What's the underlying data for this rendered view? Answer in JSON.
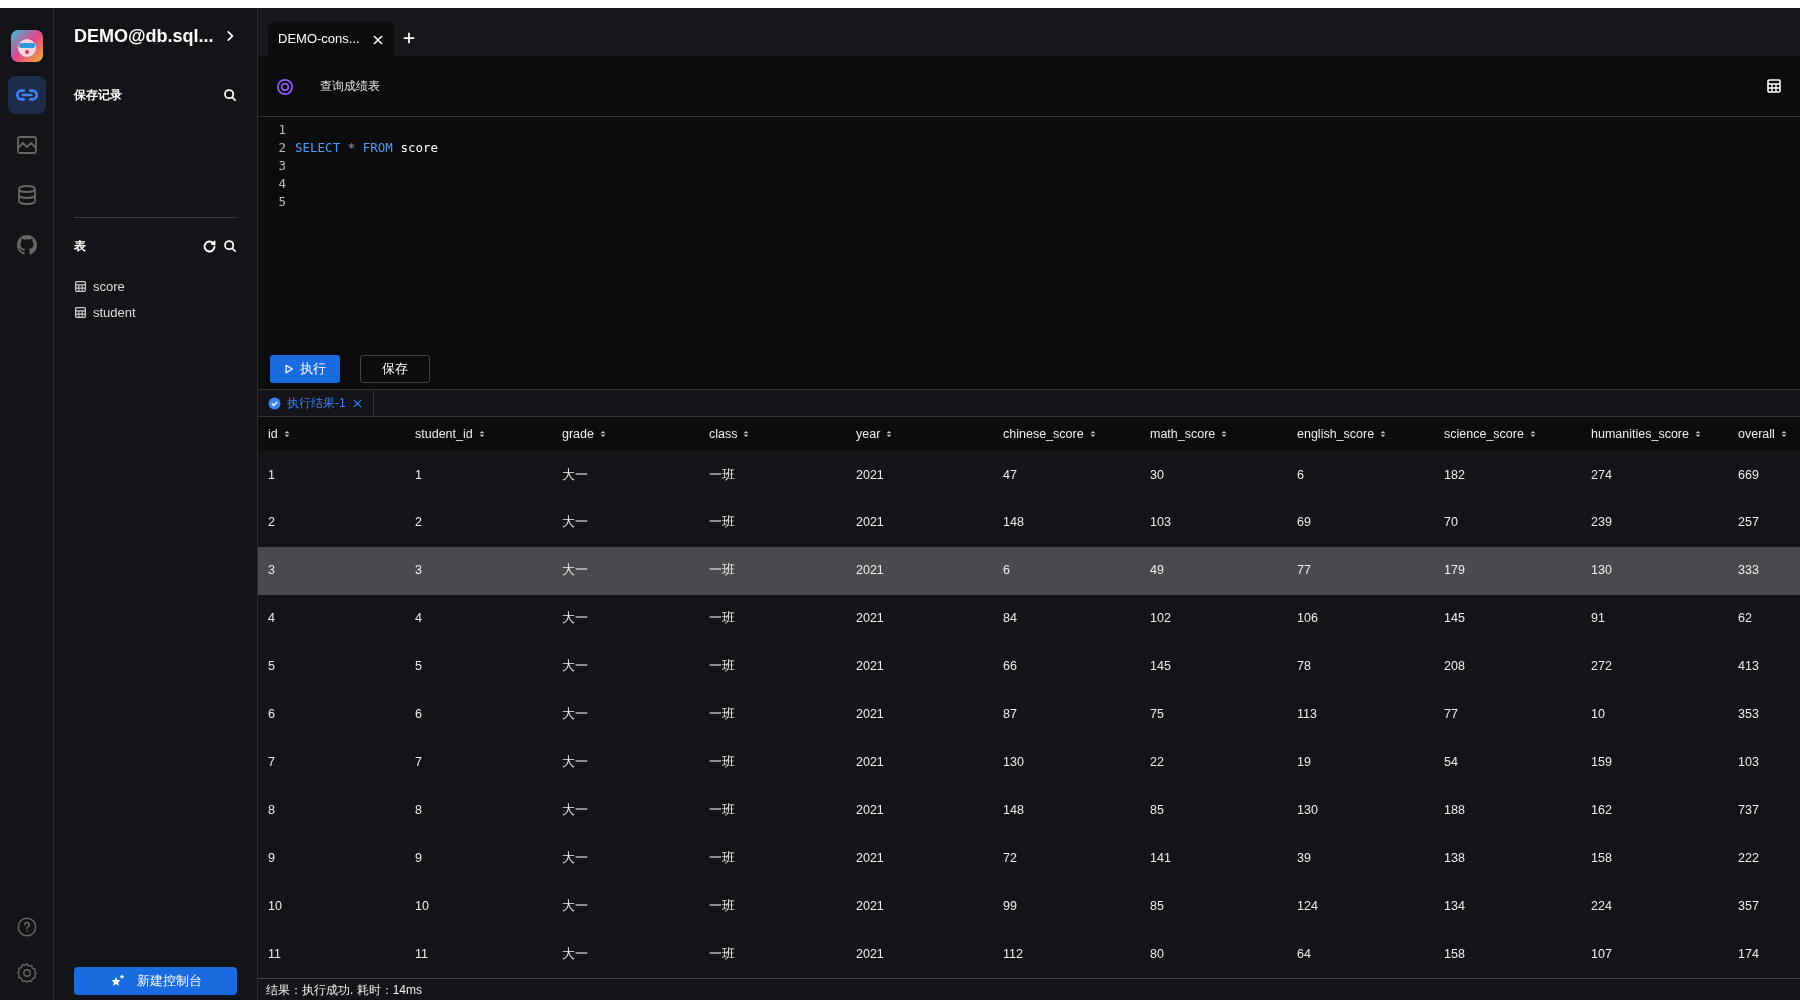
{
  "rail": [
    {
      "kind": "link",
      "selected": true
    },
    {
      "kind": "chart",
      "selected": false
    },
    {
      "kind": "database",
      "selected": false
    },
    {
      "kind": "cat",
      "selected": false
    }
  ],
  "rail_bottom": [
    {
      "kind": "help"
    },
    {
      "kind": "settings"
    }
  ],
  "connection": {
    "title": "DEMO@db.sql..."
  },
  "saved": {
    "title": "保存记录"
  },
  "tables": {
    "title": "表",
    "items": [
      {
        "name": "score"
      },
      {
        "name": "student"
      }
    ]
  },
  "new_console_button": "新建控制台",
  "tabs": [
    {
      "label": "DEMO-cons...",
      "selected": true
    }
  ],
  "query_title": "查询成绩表",
  "editor": {
    "lines": [
      {
        "number": "1"
      },
      {
        "number": "2",
        "tokens": [
          {
            "text": "SELECT",
            "kind": "keyword"
          },
          {
            "text": "*",
            "kind": "operator"
          },
          {
            "text": "FROM",
            "kind": "keyword"
          },
          {
            "text": "score",
            "kind": "name"
          }
        ]
      },
      {
        "number": "3"
      },
      {
        "number": "4"
      },
      {
        "number": "5"
      }
    ]
  },
  "buttons": {
    "run": "执行",
    "save": "保存"
  },
  "result_tabs": [
    {
      "label": "执行结果-1",
      "selected": true
    }
  ],
  "table": {
    "columns": [
      "id",
      "student_id",
      "grade",
      "class",
      "year",
      "chinese_score",
      "math_score",
      "english_score",
      "science_score",
      "humanities_score",
      "overall"
    ],
    "rows": [
      {
        "selected": false,
        "cells": [
          "1",
          "1",
          "大一",
          "一班",
          "2021",
          "47",
          "30",
          "6",
          "182",
          "274",
          "669"
        ]
      },
      {
        "selected": false,
        "cells": [
          "2",
          "2",
          "大一",
          "一班",
          "2021",
          "148",
          "103",
          "69",
          "70",
          "239",
          "257"
        ]
      },
      {
        "selected": true,
        "cells": [
          "3",
          "3",
          "大一",
          "一班",
          "2021",
          "6",
          "49",
          "77",
          "179",
          "130",
          "333"
        ]
      },
      {
        "selected": false,
        "cells": [
          "4",
          "4",
          "大一",
          "一班",
          "2021",
          "84",
          "102",
          "106",
          "145",
          "91",
          "62"
        ]
      },
      {
        "selected": false,
        "cells": [
          "5",
          "5",
          "大一",
          "一班",
          "2021",
          "66",
          "145",
          "78",
          "208",
          "272",
          "413"
        ]
      },
      {
        "selected": false,
        "cells": [
          "6",
          "6",
          "大一",
          "一班",
          "2021",
          "87",
          "75",
          "113",
          "77",
          "10",
          "353"
        ]
      },
      {
        "selected": false,
        "cells": [
          "7",
          "7",
          "大一",
          "一班",
          "2021",
          "130",
          "22",
          "19",
          "54",
          "159",
          "103"
        ]
      },
      {
        "selected": false,
        "cells": [
          "8",
          "8",
          "大一",
          "一班",
          "2021",
          "148",
          "85",
          "130",
          "188",
          "162",
          "737"
        ]
      },
      {
        "selected": false,
        "cells": [
          "9",
          "9",
          "大一",
          "一班",
          "2021",
          "72",
          "141",
          "39",
          "138",
          "158",
          "222"
        ]
      },
      {
        "selected": false,
        "cells": [
          "10",
          "10",
          "大一",
          "一班",
          "2021",
          "99",
          "85",
          "124",
          "134",
          "224",
          "357"
        ]
      },
      {
        "selected": false,
        "cells": [
          "11",
          "11",
          "大一",
          "一班",
          "2021",
          "112",
          "80",
          "64",
          "158",
          "107",
          "174"
        ]
      }
    ]
  },
  "status": "结果：执行成功. 耗时：14ms"
}
